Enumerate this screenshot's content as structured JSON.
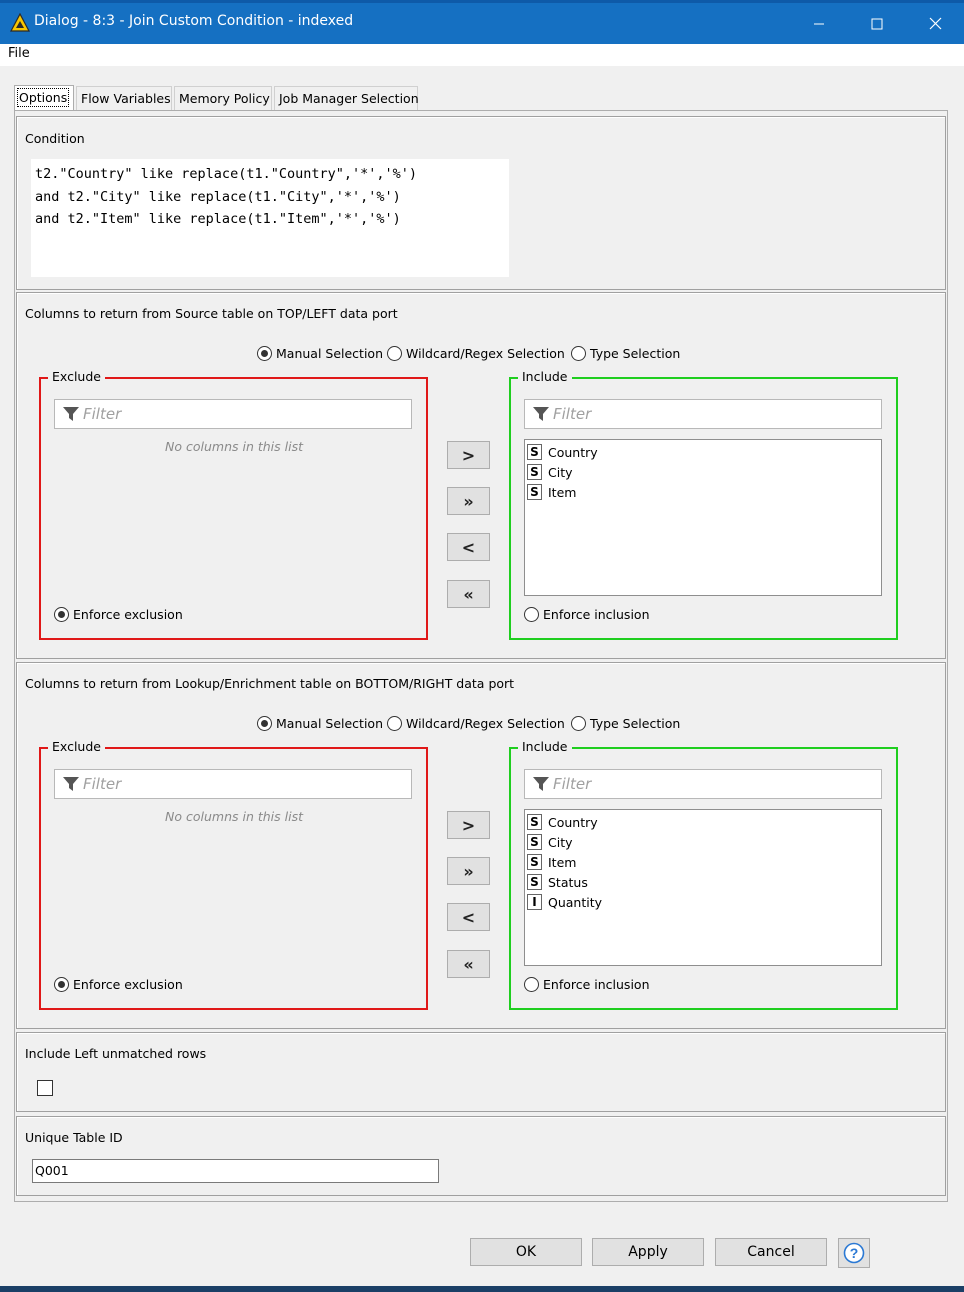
{
  "window": {
    "title": "Dialog - 8:3 - Join Custom Condition - indexed",
    "controls": {
      "minimize": "─",
      "maximize": "☐",
      "close": "✕"
    },
    "accent_color": "#1570c2"
  },
  "menu": {
    "file": "File"
  },
  "tabs": [
    "Options",
    "Flow Variables",
    "Memory Policy",
    "Job Manager Selection"
  ],
  "condition": {
    "title": "Condition",
    "text": "t2.\"Country\" like replace(t1.\"Country\",'*','%')\nand t2.\"City\" like replace(t1.\"City\",'*','%')\nand t2.\"Item\" like replace(t1.\"Item\",'*','%')"
  },
  "source_columns": {
    "title": "Columns to return from Source table on TOP/LEFT data port",
    "modes": [
      "Manual Selection",
      "Wildcard/Regex Selection",
      "Type Selection"
    ],
    "selected_mode": "Manual Selection",
    "exclude": {
      "label": "Exclude",
      "filter_placeholder": "Filter",
      "empty_message": "No columns in this list",
      "enforce_label": "Enforce exclusion",
      "enforce_checked": true
    },
    "include": {
      "label": "Include",
      "filter_placeholder": "Filter",
      "items": [
        {
          "type": "S",
          "name": "Country"
        },
        {
          "type": "S",
          "name": "City"
        },
        {
          "type": "S",
          "name": "Item"
        }
      ],
      "enforce_label": "Enforce inclusion",
      "enforce_checked": false
    },
    "buttons": [
      ">",
      "»",
      "<",
      "«"
    ]
  },
  "lookup_columns": {
    "title": "Columns to return from Lookup/Enrichment table on BOTTOM/RIGHT data port",
    "modes": [
      "Manual Selection",
      "Wildcard/Regex Selection",
      "Type Selection"
    ],
    "selected_mode": "Manual Selection",
    "exclude": {
      "label": "Exclude",
      "filter_placeholder": "Filter",
      "empty_message": "No columns in this list",
      "enforce_label": "Enforce exclusion",
      "enforce_checked": true
    },
    "include": {
      "label": "Include",
      "filter_placeholder": "Filter",
      "items": [
        {
          "type": "S",
          "name": "Country"
        },
        {
          "type": "S",
          "name": "City"
        },
        {
          "type": "S",
          "name": "Item"
        },
        {
          "type": "S",
          "name": "Status"
        },
        {
          "type": "I",
          "name": "Quantity"
        }
      ],
      "enforce_label": "Enforce inclusion",
      "enforce_checked": false
    },
    "buttons": [
      ">",
      "»",
      "<",
      "«"
    ]
  },
  "left_unmatched": {
    "title": "Include Left unmatched rows",
    "checked": false
  },
  "unique_id": {
    "title": "Unique Table ID",
    "value": "Q001"
  },
  "footer": {
    "ok": "OK",
    "apply": "Apply",
    "cancel": "Cancel",
    "help_icon": "question-icon"
  }
}
